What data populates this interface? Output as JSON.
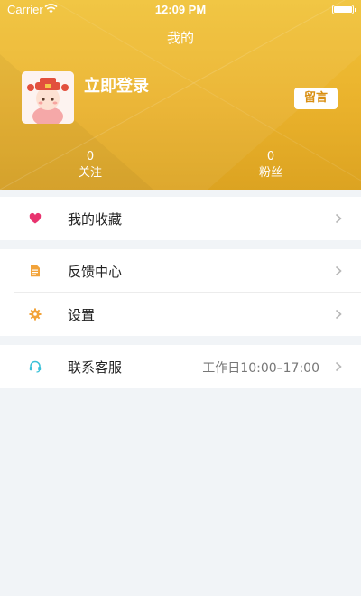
{
  "status_bar": {
    "carrier": "Carrier",
    "time": "12:09 PM"
  },
  "header": {
    "title": "我的",
    "login_text": "立即登录",
    "message_button": "留言",
    "stats": [
      {
        "value": "0",
        "label": "关注"
      },
      {
        "value": "0",
        "label": "粉丝"
      }
    ]
  },
  "menu": {
    "favorites": {
      "label": "我的收藏",
      "icon": "heart-icon",
      "icon_color": "#e8336e"
    },
    "feedback": {
      "label": "反馈中心",
      "icon": "document-icon",
      "icon_color": "#f2a33a"
    },
    "settings": {
      "label": "设置",
      "icon": "gear-icon",
      "icon_color": "#f2a33a"
    },
    "service": {
      "label": "联系客服",
      "icon": "headset-icon",
      "icon_color": "#3ac1d8",
      "value": "工作日10:00–17:00"
    }
  },
  "colors": {
    "accent": "#eab22c",
    "page_bg": "#f1f4f7",
    "button_text": "#d98f12"
  }
}
